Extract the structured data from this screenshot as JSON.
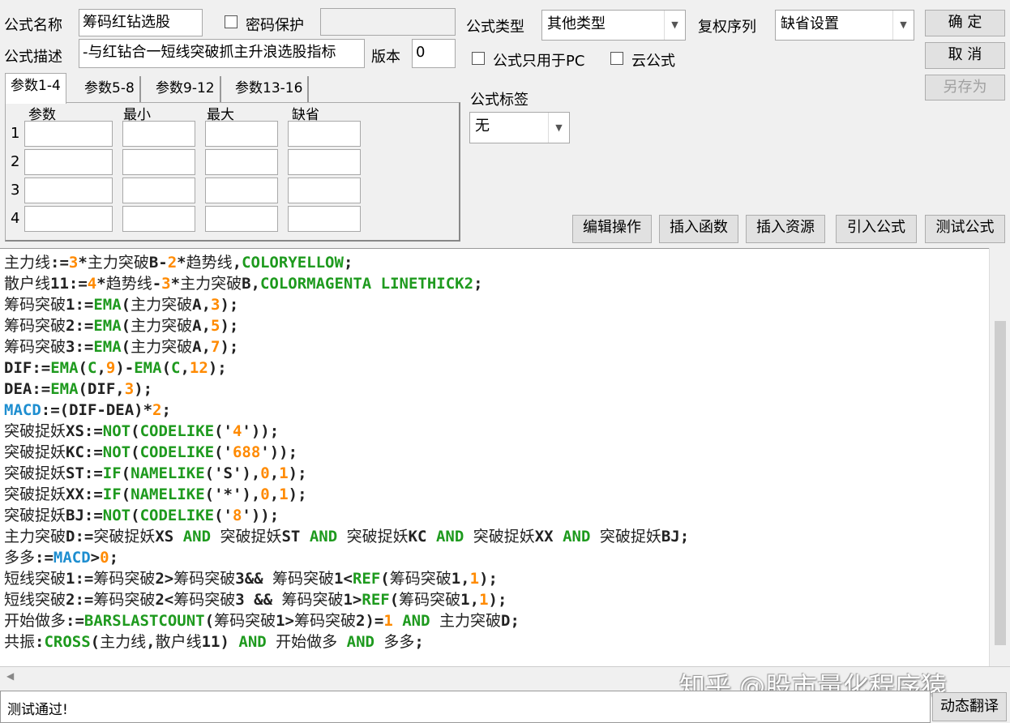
{
  "form": {
    "name_label": "公式名称",
    "name_value": "筹码红钻选股",
    "password_label": "密码保护",
    "desc_label": "公式描述",
    "desc_value": "-与红钻合一短线突破抓主升浪选股指标",
    "version_label": "版本",
    "version_value": "0",
    "type_label": "公式类型",
    "type_value": "其他类型",
    "adjust_label": "复权序列",
    "adjust_value": "缺省设置",
    "pc_only_label": "公式只用于PC",
    "cloud_label": "云公式",
    "tag_label": "公式标签",
    "tag_value": "无"
  },
  "buttons": {
    "ok": "确 定",
    "cancel": "取 消",
    "save_as": "另存为",
    "edit": "编辑操作",
    "insert_func": "插入函数",
    "insert_res": "插入资源",
    "import": "引入公式",
    "test": "测试公式",
    "translate": "动态翻译"
  },
  "tabs": [
    "参数1-4",
    "参数5-8",
    "参数9-12",
    "参数13-16"
  ],
  "params": {
    "headers": [
      "参数",
      "最小",
      "最大",
      "缺省"
    ],
    "rows": [
      "1",
      "2",
      "3",
      "4"
    ]
  },
  "code_lines": [
    [
      [
        "主力线",
        "t"
      ],
      [
        ":=",
        "a"
      ],
      [
        "3",
        "n"
      ],
      [
        "*",
        "a"
      ],
      [
        "主力突破",
        "t"
      ],
      [
        "B-",
        "a"
      ],
      [
        "2",
        "n"
      ],
      [
        "*",
        "a"
      ],
      [
        "趋势线",
        "t"
      ],
      [
        ",",
        "a"
      ],
      [
        "COLORYELLOW",
        "f"
      ],
      [
        ";",
        "a"
      ]
    ],
    [
      [
        "散户线",
        "t"
      ],
      [
        "11:=",
        "a"
      ],
      [
        "4",
        "n"
      ],
      [
        "*",
        "a"
      ],
      [
        "趋势线",
        "t"
      ],
      [
        "-",
        "a"
      ],
      [
        "3",
        "n"
      ],
      [
        "*",
        "a"
      ],
      [
        "主力突破",
        "t"
      ],
      [
        "B,",
        "a"
      ],
      [
        "COLORMAGENTA LINETHICK2",
        "f"
      ],
      [
        ";",
        "a"
      ]
    ],
    [
      [
        "筹码突破",
        "t"
      ],
      [
        "1:=",
        "a"
      ],
      [
        "EMA",
        "f"
      ],
      [
        "(",
        "a"
      ],
      [
        "主力突破",
        "t"
      ],
      [
        "A,",
        "a"
      ],
      [
        "3",
        "n"
      ],
      [
        ");",
        "a"
      ]
    ],
    [
      [
        "筹码突破",
        "t"
      ],
      [
        "2:=",
        "a"
      ],
      [
        "EMA",
        "f"
      ],
      [
        "(",
        "a"
      ],
      [
        "主力突破",
        "t"
      ],
      [
        "A,",
        "a"
      ],
      [
        "5",
        "n"
      ],
      [
        ");",
        "a"
      ]
    ],
    [
      [
        "筹码突破",
        "t"
      ],
      [
        "3:=",
        "a"
      ],
      [
        "EMA",
        "f"
      ],
      [
        "(",
        "a"
      ],
      [
        "主力突破",
        "t"
      ],
      [
        "A,",
        "a"
      ],
      [
        "7",
        "n"
      ],
      [
        ");",
        "a"
      ]
    ],
    [
      [
        "DIF:=",
        "a"
      ],
      [
        "EMA",
        "f"
      ],
      [
        "(",
        "a"
      ],
      [
        "C",
        "f"
      ],
      [
        ",",
        "a"
      ],
      [
        "9",
        "n"
      ],
      [
        ")-",
        "a"
      ],
      [
        "EMA",
        "f"
      ],
      [
        "(",
        "a"
      ],
      [
        "C",
        "f"
      ],
      [
        ",",
        "a"
      ],
      [
        "12",
        "n"
      ],
      [
        ");",
        "a"
      ]
    ],
    [
      [
        "DEA:=",
        "a"
      ],
      [
        "EMA",
        "f"
      ],
      [
        "(DIF,",
        "a"
      ],
      [
        "3",
        "n"
      ],
      [
        ");",
        "a"
      ]
    ],
    [
      [
        "MACD",
        "m"
      ],
      [
        ":=(DIF-DEA)*",
        "a"
      ],
      [
        "2",
        "n"
      ],
      [
        ";",
        "a"
      ]
    ],
    [
      [
        "突破捉妖",
        "t"
      ],
      [
        "XS:=",
        "a"
      ],
      [
        "NOT",
        "f"
      ],
      [
        "(",
        "a"
      ],
      [
        "CODELIKE",
        "f"
      ],
      [
        "('",
        "a"
      ],
      [
        "4",
        "n"
      ],
      [
        "'));",
        "a"
      ]
    ],
    [
      [
        "突破捉妖",
        "t"
      ],
      [
        "KC:=",
        "a"
      ],
      [
        "NOT",
        "f"
      ],
      [
        "(",
        "a"
      ],
      [
        "CODELIKE",
        "f"
      ],
      [
        "('",
        "a"
      ],
      [
        "688",
        "n"
      ],
      [
        "'));",
        "a"
      ]
    ],
    [
      [
        "突破捉妖",
        "t"
      ],
      [
        "ST:=",
        "a"
      ],
      [
        "IF",
        "f"
      ],
      [
        "(",
        "a"
      ],
      [
        "NAMELIKE",
        "f"
      ],
      [
        "('S'),",
        "a"
      ],
      [
        "0",
        "n"
      ],
      [
        ",",
        "a"
      ],
      [
        "1",
        "n"
      ],
      [
        ");",
        "a"
      ]
    ],
    [
      [
        "突破捉妖",
        "t"
      ],
      [
        "XX:=",
        "a"
      ],
      [
        "IF",
        "f"
      ],
      [
        "(",
        "a"
      ],
      [
        "NAMELIKE",
        "f"
      ],
      [
        "('*'),",
        "a"
      ],
      [
        "0",
        "n"
      ],
      [
        ",",
        "a"
      ],
      [
        "1",
        "n"
      ],
      [
        ");",
        "a"
      ]
    ],
    [
      [
        "突破捉妖",
        "t"
      ],
      [
        "BJ:=",
        "a"
      ],
      [
        "NOT",
        "f"
      ],
      [
        "(",
        "a"
      ],
      [
        "CODELIKE",
        "f"
      ],
      [
        "('",
        "a"
      ],
      [
        "8",
        "n"
      ],
      [
        "'));",
        "a"
      ]
    ],
    [
      [
        "主力突破",
        "t"
      ],
      [
        "D:=",
        "a"
      ],
      [
        "突破捉妖",
        "t"
      ],
      [
        "XS ",
        "a"
      ],
      [
        "AND",
        "f"
      ],
      [
        " ",
        "a"
      ],
      [
        "突破捉妖",
        "t"
      ],
      [
        "ST ",
        "a"
      ],
      [
        "AND",
        "f"
      ],
      [
        " ",
        "a"
      ],
      [
        "突破捉妖",
        "t"
      ],
      [
        "KC ",
        "a"
      ],
      [
        "AND",
        "f"
      ],
      [
        " ",
        "a"
      ],
      [
        "突破捉妖",
        "t"
      ],
      [
        "XX ",
        "a"
      ],
      [
        "AND",
        "f"
      ],
      [
        " ",
        "a"
      ],
      [
        "突破捉妖",
        "t"
      ],
      [
        "BJ;",
        "a"
      ]
    ],
    [
      [
        "多多",
        "t"
      ],
      [
        ":=",
        "a"
      ],
      [
        "MACD",
        "m"
      ],
      [
        ">",
        "a"
      ],
      [
        "0",
        "n"
      ],
      [
        ";",
        "a"
      ]
    ],
    [
      [
        "短线突破",
        "t"
      ],
      [
        "1:=",
        "a"
      ],
      [
        "筹码突破",
        "t"
      ],
      [
        "2>",
        "a"
      ],
      [
        "筹码突破",
        "t"
      ],
      [
        "3&& ",
        "a"
      ],
      [
        "筹码突破",
        "t"
      ],
      [
        "1<",
        "a"
      ],
      [
        "REF",
        "f"
      ],
      [
        "(",
        "a"
      ],
      [
        "筹码突破",
        "t"
      ],
      [
        "1,",
        "a"
      ],
      [
        "1",
        "n"
      ],
      [
        ");",
        "a"
      ]
    ],
    [
      [
        "短线突破",
        "t"
      ],
      [
        "2:=",
        "a"
      ],
      [
        "筹码突破",
        "t"
      ],
      [
        "2<",
        "a"
      ],
      [
        "筹码突破",
        "t"
      ],
      [
        "3 && ",
        "a"
      ],
      [
        "筹码突破",
        "t"
      ],
      [
        "1>",
        "a"
      ],
      [
        "REF",
        "f"
      ],
      [
        "(",
        "a"
      ],
      [
        "筹码突破",
        "t"
      ],
      [
        "1,",
        "a"
      ],
      [
        "1",
        "n"
      ],
      [
        ");",
        "a"
      ]
    ],
    [
      [
        "开始做多",
        "t"
      ],
      [
        ":=",
        "a"
      ],
      [
        "BARSLASTCOUNT",
        "f"
      ],
      [
        "(",
        "a"
      ],
      [
        "筹码突破",
        "t"
      ],
      [
        "1>",
        "a"
      ],
      [
        "筹码突破",
        "t"
      ],
      [
        "2)=",
        "a"
      ],
      [
        "1",
        "n"
      ],
      [
        " ",
        "a"
      ],
      [
        "AND",
        "f"
      ],
      [
        " ",
        "a"
      ],
      [
        "主力突破",
        "t"
      ],
      [
        "D;",
        "a"
      ]
    ],
    [
      [
        "共振",
        "t"
      ],
      [
        ":",
        "a"
      ],
      [
        "CROSS",
        "f"
      ],
      [
        "(",
        "a"
      ],
      [
        "主力线",
        "t"
      ],
      [
        ",",
        "a"
      ],
      [
        "散户线",
        "t"
      ],
      [
        "11) ",
        "a"
      ],
      [
        "AND",
        "f"
      ],
      [
        " ",
        "a"
      ],
      [
        "开始做多",
        "t"
      ],
      [
        " ",
        "a"
      ],
      [
        "AND",
        "f"
      ],
      [
        " ",
        "a"
      ],
      [
        "多多",
        "t"
      ],
      [
        ";",
        "a"
      ]
    ]
  ],
  "status": "测试通过!",
  "watermark": "知乎 @股市量化程序猿",
  "colors": {
    "function": "#1e9a1e",
    "number": "#ff8a00",
    "macd": "#1e8ed0"
  }
}
